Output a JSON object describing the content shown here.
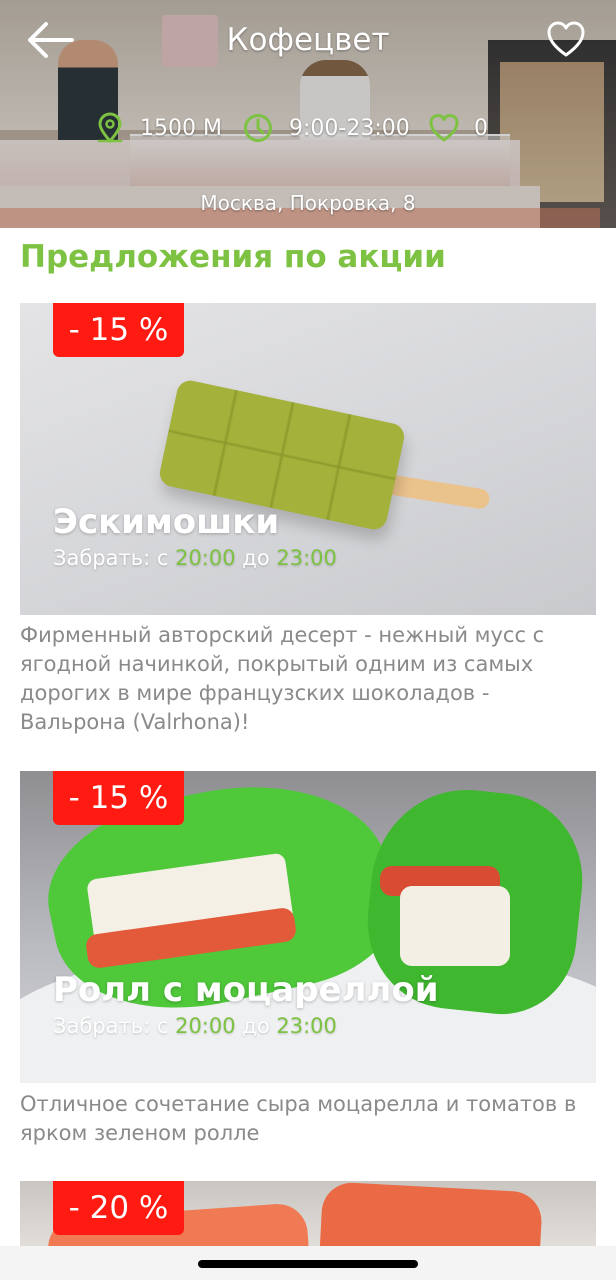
{
  "header": {
    "title": "Кофецвет",
    "distance": "1500 М",
    "hours": "9:00-23:00",
    "likes": "0",
    "address": "Москва, Покровка, 8"
  },
  "icons": {
    "back": "arrow-left-icon",
    "favorite": "heart-outline-icon",
    "distance": "location-pin-icon",
    "hours": "clock-icon",
    "likes": "heart-icon"
  },
  "section": {
    "title": "Предложения по акции"
  },
  "offers": [
    {
      "discount": "- 15 %",
      "name": "Эскимошки",
      "pickup_prefix": "Забрать: с",
      "from": "20:00",
      "to_word": "до",
      "to": "23:00",
      "description": "Фирменный авторский десерт - нежный мусс с ягодной начинкой, покрытый одним из самых дорогих в мире французских шоколадов - Вальрона (Valrhona)!"
    },
    {
      "discount": "- 15 %",
      "name": "Ролл с моцареллой",
      "pickup_prefix": "Забрать: с",
      "from": "20:00",
      "to_word": "до",
      "to": "23:00",
      "description": "Отличное сочетание сыра моцарелла и томатов в ярком зеленом ролле"
    },
    {
      "discount": "- 20 %"
    }
  ],
  "colors": {
    "accent_green": "#7dc242",
    "badge_red": "#ff1a12",
    "description_gray": "#8a8a8a"
  }
}
